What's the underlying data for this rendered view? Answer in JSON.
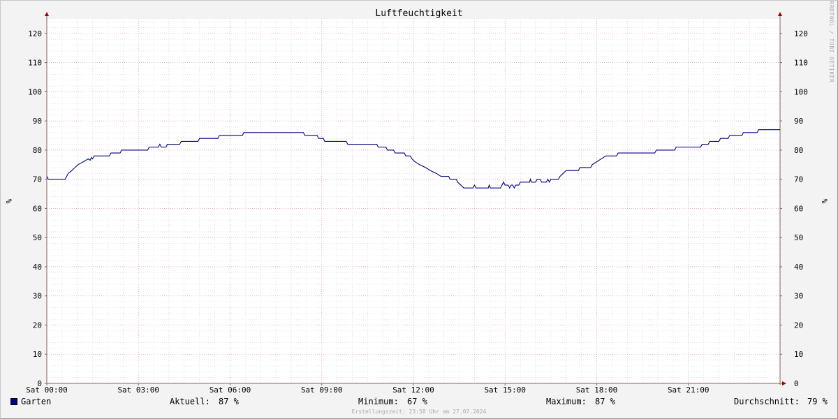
{
  "chart_data": {
    "type": "line",
    "title": "Luftfeuchtigkeit",
    "ylabel": "%",
    "ylim": [
      0,
      125
    ],
    "yticks": [
      0,
      10,
      20,
      30,
      40,
      50,
      60,
      70,
      80,
      90,
      100,
      110,
      120
    ],
    "xlim_hours": [
      0,
      24
    ],
    "xticks": [
      {
        "hour": 0,
        "label": "Sat 00:00"
      },
      {
        "hour": 3,
        "label": "Sat 03:00"
      },
      {
        "hour": 6,
        "label": "Sat 06:00"
      },
      {
        "hour": 9,
        "label": "Sat 09:00"
      },
      {
        "hour": 12,
        "label": "Sat 12:00"
      },
      {
        "hour": 15,
        "label": "Sat 15:00"
      },
      {
        "hour": 18,
        "label": "Sat 18:00"
      },
      {
        "hour": 21,
        "label": "Sat 21:00"
      }
    ],
    "grid": true,
    "series": [
      {
        "name": "Garten",
        "color": "#000080",
        "points": [
          [
            0.0,
            71
          ],
          [
            0.05,
            70
          ],
          [
            0.6,
            70
          ],
          [
            0.65,
            71
          ],
          [
            0.7,
            72
          ],
          [
            0.82,
            73
          ],
          [
            0.92,
            74
          ],
          [
            1.02,
            75
          ],
          [
            1.2,
            76
          ],
          [
            1.36,
            77
          ],
          [
            1.42,
            76.5
          ],
          [
            1.46,
            77.5
          ],
          [
            1.5,
            77
          ],
          [
            1.55,
            78
          ],
          [
            2.05,
            78
          ],
          [
            2.1,
            79
          ],
          [
            2.4,
            79
          ],
          [
            2.45,
            80
          ],
          [
            3.3,
            80
          ],
          [
            3.35,
            81
          ],
          [
            3.65,
            81
          ],
          [
            3.7,
            82
          ],
          [
            3.75,
            81
          ],
          [
            3.9,
            81
          ],
          [
            3.95,
            82
          ],
          [
            4.35,
            82
          ],
          [
            4.4,
            83
          ],
          [
            4.95,
            83
          ],
          [
            5.0,
            84
          ],
          [
            5.6,
            84
          ],
          [
            5.65,
            85
          ],
          [
            6.4,
            85
          ],
          [
            6.45,
            86
          ],
          [
            8.4,
            86
          ],
          [
            8.45,
            85
          ],
          [
            8.85,
            85
          ],
          [
            8.9,
            84
          ],
          [
            9.05,
            84
          ],
          [
            9.1,
            83
          ],
          [
            9.8,
            83
          ],
          [
            9.85,
            82
          ],
          [
            10.8,
            82
          ],
          [
            10.85,
            81
          ],
          [
            11.1,
            81
          ],
          [
            11.15,
            80
          ],
          [
            11.35,
            80
          ],
          [
            11.4,
            79
          ],
          [
            11.7,
            79
          ],
          [
            11.75,
            78
          ],
          [
            11.9,
            78
          ],
          [
            11.95,
            77
          ],
          [
            12.05,
            76
          ],
          [
            12.2,
            75
          ],
          [
            12.4,
            74
          ],
          [
            12.55,
            73
          ],
          [
            12.75,
            72
          ],
          [
            12.9,
            71
          ],
          [
            13.15,
            71
          ],
          [
            13.2,
            70
          ],
          [
            13.4,
            70
          ],
          [
            13.45,
            69
          ],
          [
            13.55,
            68
          ],
          [
            13.65,
            67
          ],
          [
            13.95,
            67
          ],
          [
            14.0,
            68
          ],
          [
            14.05,
            67
          ],
          [
            14.45,
            67
          ],
          [
            14.48,
            68
          ],
          [
            14.52,
            67
          ],
          [
            14.85,
            67
          ],
          [
            14.9,
            68
          ],
          [
            14.95,
            69
          ],
          [
            15.0,
            68
          ],
          [
            15.1,
            68
          ],
          [
            15.15,
            67
          ],
          [
            15.2,
            68
          ],
          [
            15.25,
            68
          ],
          [
            15.3,
            67
          ],
          [
            15.35,
            68
          ],
          [
            15.45,
            68
          ],
          [
            15.5,
            69
          ],
          [
            15.8,
            69
          ],
          [
            15.83,
            70
          ],
          [
            15.86,
            69
          ],
          [
            16.0,
            69
          ],
          [
            16.05,
            70
          ],
          [
            16.15,
            70
          ],
          [
            16.2,
            69
          ],
          [
            16.35,
            69
          ],
          [
            16.4,
            70
          ],
          [
            16.45,
            69
          ],
          [
            16.5,
            70
          ],
          [
            16.75,
            70
          ],
          [
            16.8,
            71
          ],
          [
            16.9,
            72
          ],
          [
            17.0,
            73
          ],
          [
            17.4,
            73
          ],
          [
            17.45,
            74
          ],
          [
            17.8,
            74
          ],
          [
            17.85,
            75
          ],
          [
            18.0,
            76
          ],
          [
            18.15,
            77
          ],
          [
            18.3,
            78
          ],
          [
            18.65,
            78
          ],
          [
            18.7,
            79
          ],
          [
            19.9,
            79
          ],
          [
            19.95,
            80
          ],
          [
            20.55,
            80
          ],
          [
            20.6,
            81
          ],
          [
            21.4,
            81
          ],
          [
            21.45,
            82
          ],
          [
            21.65,
            82
          ],
          [
            21.7,
            83
          ],
          [
            22.0,
            83
          ],
          [
            22.05,
            84
          ],
          [
            22.3,
            84
          ],
          [
            22.35,
            85
          ],
          [
            22.75,
            85
          ],
          [
            22.8,
            86
          ],
          [
            23.25,
            86
          ],
          [
            23.3,
            87
          ],
          [
            24.0,
            87
          ]
        ]
      }
    ]
  },
  "legend": {
    "series_name": "Garten",
    "swatch_color": "#000080",
    "current_label": "Aktuell:",
    "current_value": "87 %",
    "min_label": "Minimum:",
    "min_value": "67 %",
    "max_label": "Maximum:",
    "max_value": "87 %",
    "avg_label": "Durchschnitt:",
    "avg_value": "79 %"
  },
  "footer_text": "Erstellungszeit: 23:58 Uhr am 27.07.2024",
  "watermark": "RRDTOOL / TOBI OETIKER",
  "colors": {
    "background": "#f3f3f3",
    "plot_background": "#ffffff",
    "major_grid": "#e8a0a8",
    "minor_grid": "#d8d8d8",
    "axis": "#8b5e5e",
    "arrow": "#a00000"
  }
}
